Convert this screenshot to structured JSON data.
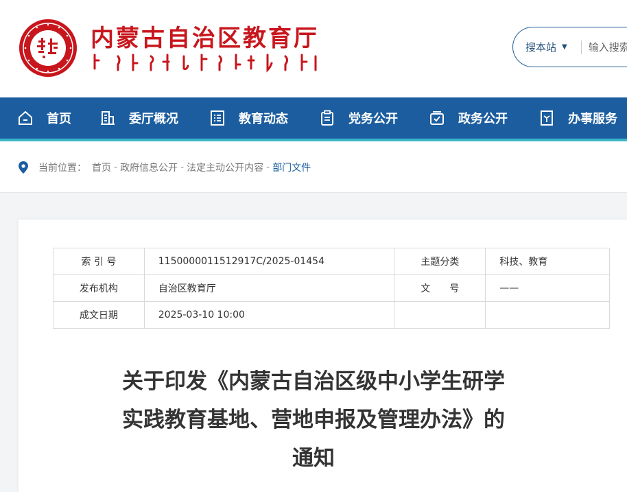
{
  "header": {
    "site_title": "内蒙古自治区教育厅",
    "search": {
      "scope_label": "搜本站",
      "placeholder": "输入搜索"
    }
  },
  "colors": {
    "nav_bg": "#1b5d9f",
    "accent_red": "#c8161d",
    "accent_teal": "#3ab6c8"
  },
  "nav": {
    "items": [
      {
        "label": "首页",
        "icon": "home-icon",
        "active": true
      },
      {
        "label": "委厅概况",
        "icon": "building-icon"
      },
      {
        "label": "教育动态",
        "icon": "list-doc-icon"
      },
      {
        "label": "党务公开",
        "icon": "clipboard-icon"
      },
      {
        "label": "政务公开",
        "icon": "tray-check-icon"
      },
      {
        "label": "办事服务",
        "icon": "service-doc-icon"
      }
    ]
  },
  "breadcrumb": {
    "prefix": "当前位置：",
    "items": [
      "首页",
      "政府信息公开",
      "法定主动公开内容",
      "部门文件"
    ]
  },
  "meta": {
    "index_no_label": "索 引 号",
    "index_no": "11500000115129​17C/2025-01454",
    "topic_label": "主题分类",
    "topic": "科技、教育",
    "publisher_label": "发布机构",
    "publisher": "自治区教育厅",
    "doc_no_label": "文　　号",
    "doc_no": "——",
    "date_label": "成文日期",
    "date": "2025-03-10 10:00"
  },
  "document": {
    "title_line1": "关于印发《内蒙古自治区级中小学生研学",
    "title_line2": "实践教育基地、营地申报及管理办法》的",
    "title_line3": "通知"
  }
}
